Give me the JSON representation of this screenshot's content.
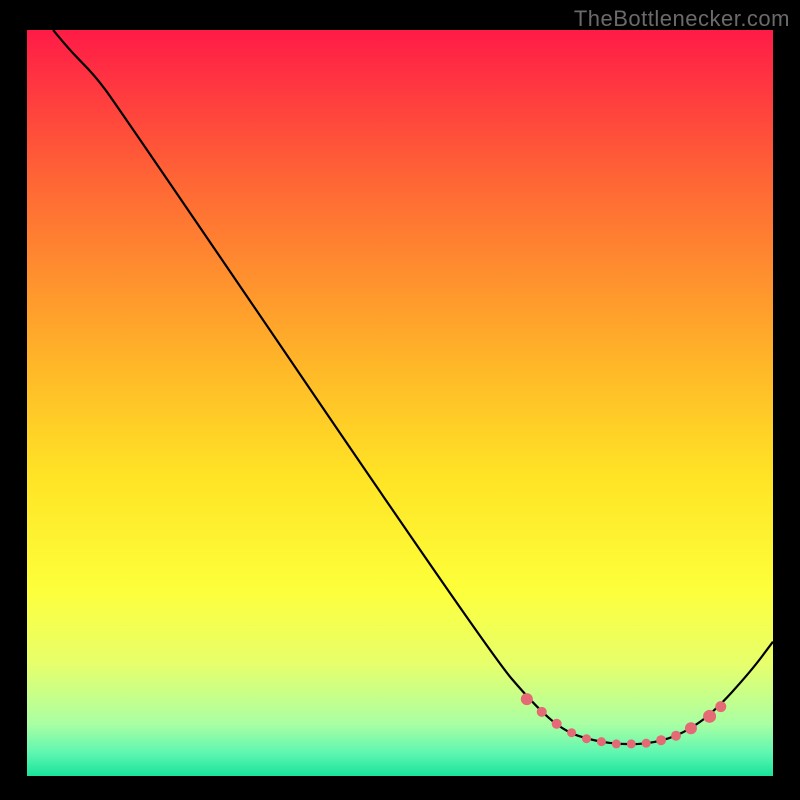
{
  "watermark": "TheBottlenecker.com",
  "chart_data": {
    "type": "line",
    "title": "",
    "xlabel": "",
    "ylabel": "",
    "xlim": [
      0,
      100
    ],
    "ylim": [
      0,
      100
    ],
    "gradient_stops": [
      {
        "offset": 0.0,
        "color": "#ff1b47"
      },
      {
        "offset": 0.2,
        "color": "#ff6535"
      },
      {
        "offset": 0.45,
        "color": "#ffb728"
      },
      {
        "offset": 0.6,
        "color": "#ffe425"
      },
      {
        "offset": 0.75,
        "color": "#fdff3a"
      },
      {
        "offset": 0.85,
        "color": "#e7ff6c"
      },
      {
        "offset": 0.93,
        "color": "#aaffa3"
      },
      {
        "offset": 0.97,
        "color": "#5cf6b1"
      },
      {
        "offset": 1.0,
        "color": "#19e39a"
      }
    ],
    "series": [
      {
        "name": "bottleneck-curve",
        "color": "#000000",
        "points": [
          {
            "x": 3.5,
            "y": 100.0
          },
          {
            "x": 6.0,
            "y": 97.0
          },
          {
            "x": 9.0,
            "y": 94.0
          },
          {
            "x": 12.0,
            "y": 90.0
          },
          {
            "x": 62.0,
            "y": 16.5
          },
          {
            "x": 68.0,
            "y": 9.5
          },
          {
            "x": 72.0,
            "y": 6.0
          },
          {
            "x": 76.0,
            "y": 4.7
          },
          {
            "x": 80.0,
            "y": 4.2
          },
          {
            "x": 84.0,
            "y": 4.4
          },
          {
            "x": 88.0,
            "y": 5.7
          },
          {
            "x": 92.0,
            "y": 8.5
          },
          {
            "x": 97.0,
            "y": 14.0
          },
          {
            "x": 100.0,
            "y": 18.0
          }
        ]
      }
    ],
    "markers": {
      "name": "optimal-range-markers",
      "color": "#e46a76",
      "radius_pattern": [
        6,
        5,
        5,
        4.5,
        4.5,
        4.5,
        4.5,
        4.5,
        4.5,
        5,
        5,
        6,
        6.5,
        5.5
      ],
      "points": [
        {
          "x": 67.0,
          "y": 10.3
        },
        {
          "x": 69.0,
          "y": 8.6
        },
        {
          "x": 71.0,
          "y": 7.0
        },
        {
          "x": 73.0,
          "y": 5.8
        },
        {
          "x": 75.0,
          "y": 5.0
        },
        {
          "x": 77.0,
          "y": 4.6
        },
        {
          "x": 79.0,
          "y": 4.3
        },
        {
          "x": 81.0,
          "y": 4.3
        },
        {
          "x": 83.0,
          "y": 4.4
        },
        {
          "x": 85.0,
          "y": 4.8
        },
        {
          "x": 87.0,
          "y": 5.4
        },
        {
          "x": 89.0,
          "y": 6.4
        },
        {
          "x": 91.5,
          "y": 8.0
        },
        {
          "x": 93.0,
          "y": 9.3
        }
      ]
    }
  }
}
